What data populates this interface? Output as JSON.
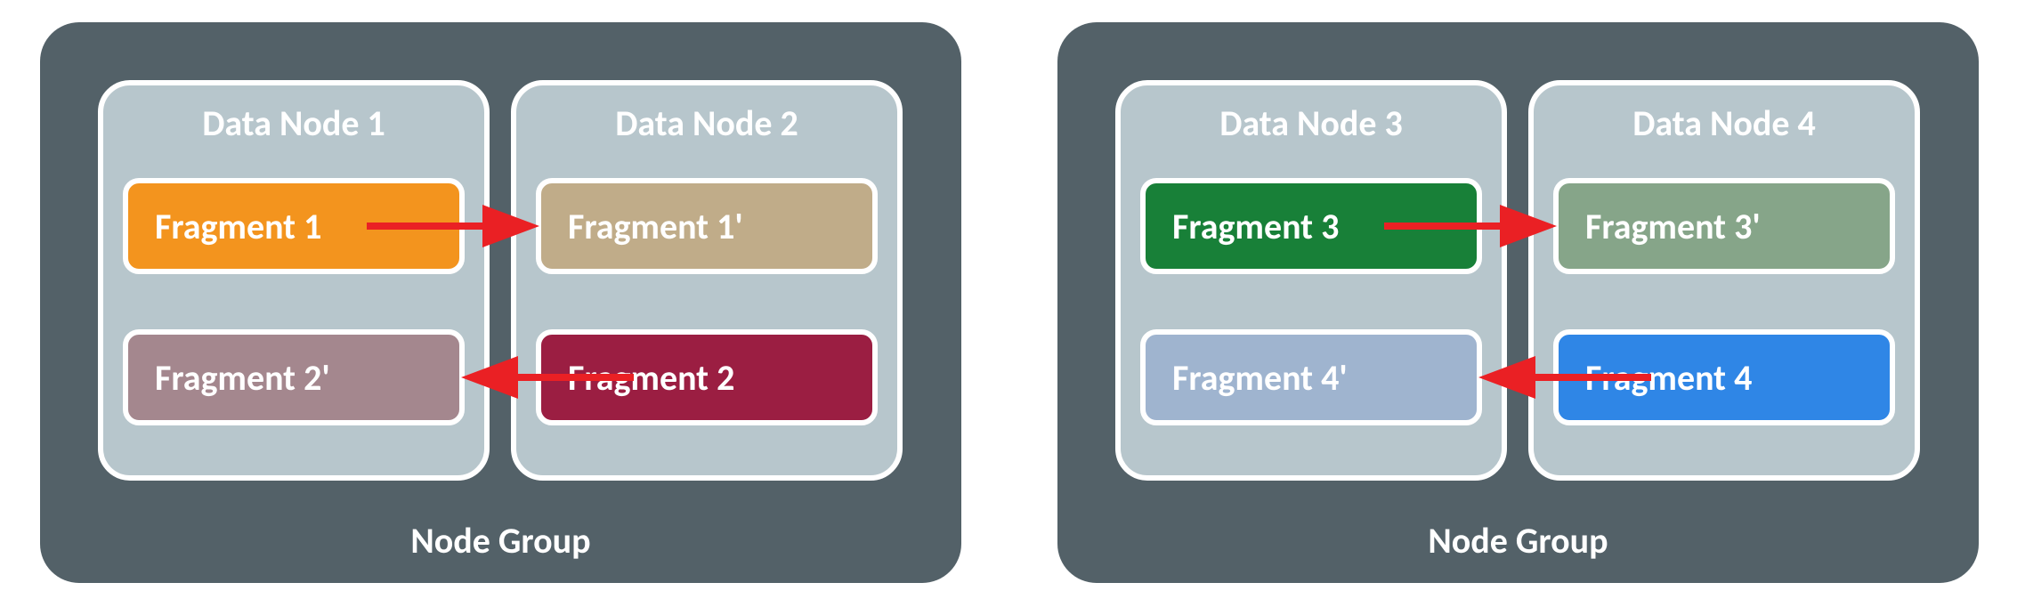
{
  "groups": [
    {
      "label": "Node Group",
      "nodes": [
        {
          "label": "Data Node 1"
        },
        {
          "label": "Data Node 2"
        }
      ]
    },
    {
      "label": "Node Group",
      "nodes": [
        {
          "label": "Data Node 3"
        },
        {
          "label": "Data Node 4"
        }
      ]
    }
  ],
  "fragments": {
    "f1": {
      "label": "Fragment 1",
      "color": "#F3941E"
    },
    "f1p": {
      "label": "Fragment 1'",
      "color": "#C0AC89"
    },
    "f2": {
      "label": "Fragment 2",
      "color": "#9B1E42"
    },
    "f2p": {
      "label": "Fragment 2'",
      "color": "#A4878E"
    },
    "f3": {
      "label": "Fragment 3",
      "color": "#188038"
    },
    "f3p": {
      "label": "Fragment 3'",
      "color": "#86A589"
    },
    "f4": {
      "label": "Fragment 4",
      "color": "#2F86E6"
    },
    "f4p": {
      "label": "Fragment 4'",
      "color": "#9FB4CF"
    }
  },
  "colors": {
    "groupBg": "#536168",
    "nodeBg": "#B7C6CC",
    "border": "#FFFFFF",
    "arrow": "#EA2024"
  }
}
